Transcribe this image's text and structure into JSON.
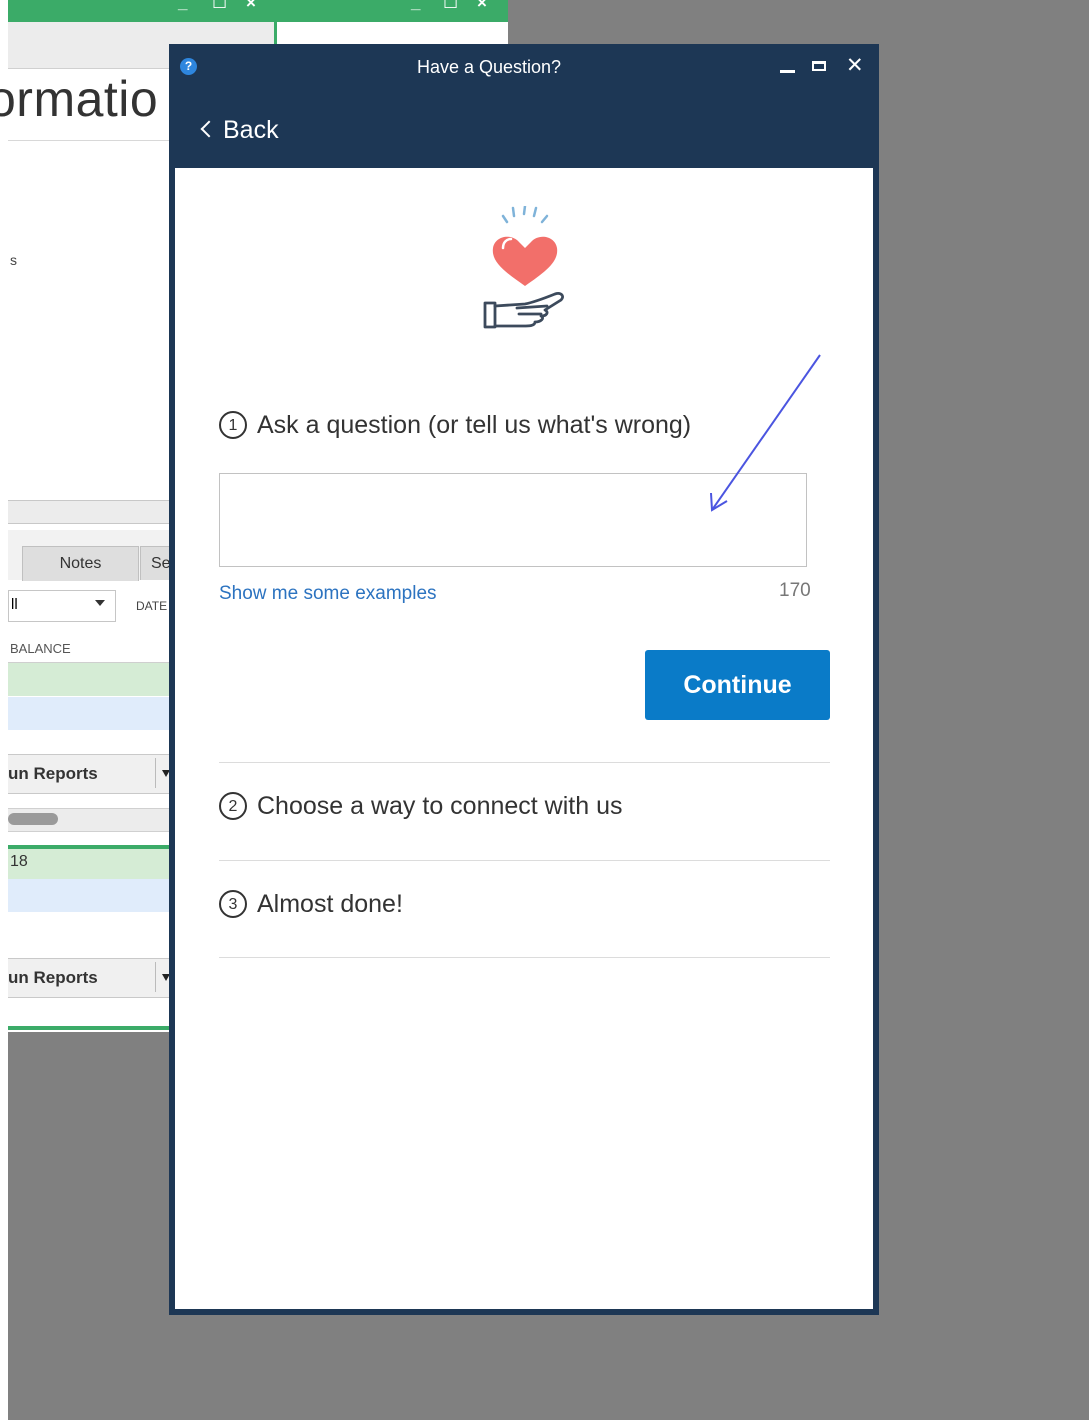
{
  "background_window": {
    "heading_fragment": "ormatio",
    "text_fragment": "s",
    "tabs": [
      "Notes",
      "Se"
    ],
    "filter_value": "ll",
    "date_label": "DATE",
    "balance_header": "BALANCE",
    "run_reports_label": "un Reports",
    "row_value": "18"
  },
  "dialog": {
    "title": "Have a Question?",
    "help_icon": "?",
    "back_label": "Back",
    "steps": [
      {
        "number": "1",
        "label": "Ask a question (or tell us what's wrong)"
      },
      {
        "number": "2",
        "label": "Choose a way to connect with us"
      },
      {
        "number": "3",
        "label": "Almost done!"
      }
    ],
    "question_input": {
      "value": ""
    },
    "examples_link": "Show me some examples",
    "char_count": "170",
    "continue_label": "Continue",
    "colors": {
      "title_bar": "#1d3755",
      "primary_button": "#0a7bc8",
      "link": "#2c73c0",
      "heart": "#f26f6a",
      "annotation_arrow": "#4b55e0"
    }
  }
}
